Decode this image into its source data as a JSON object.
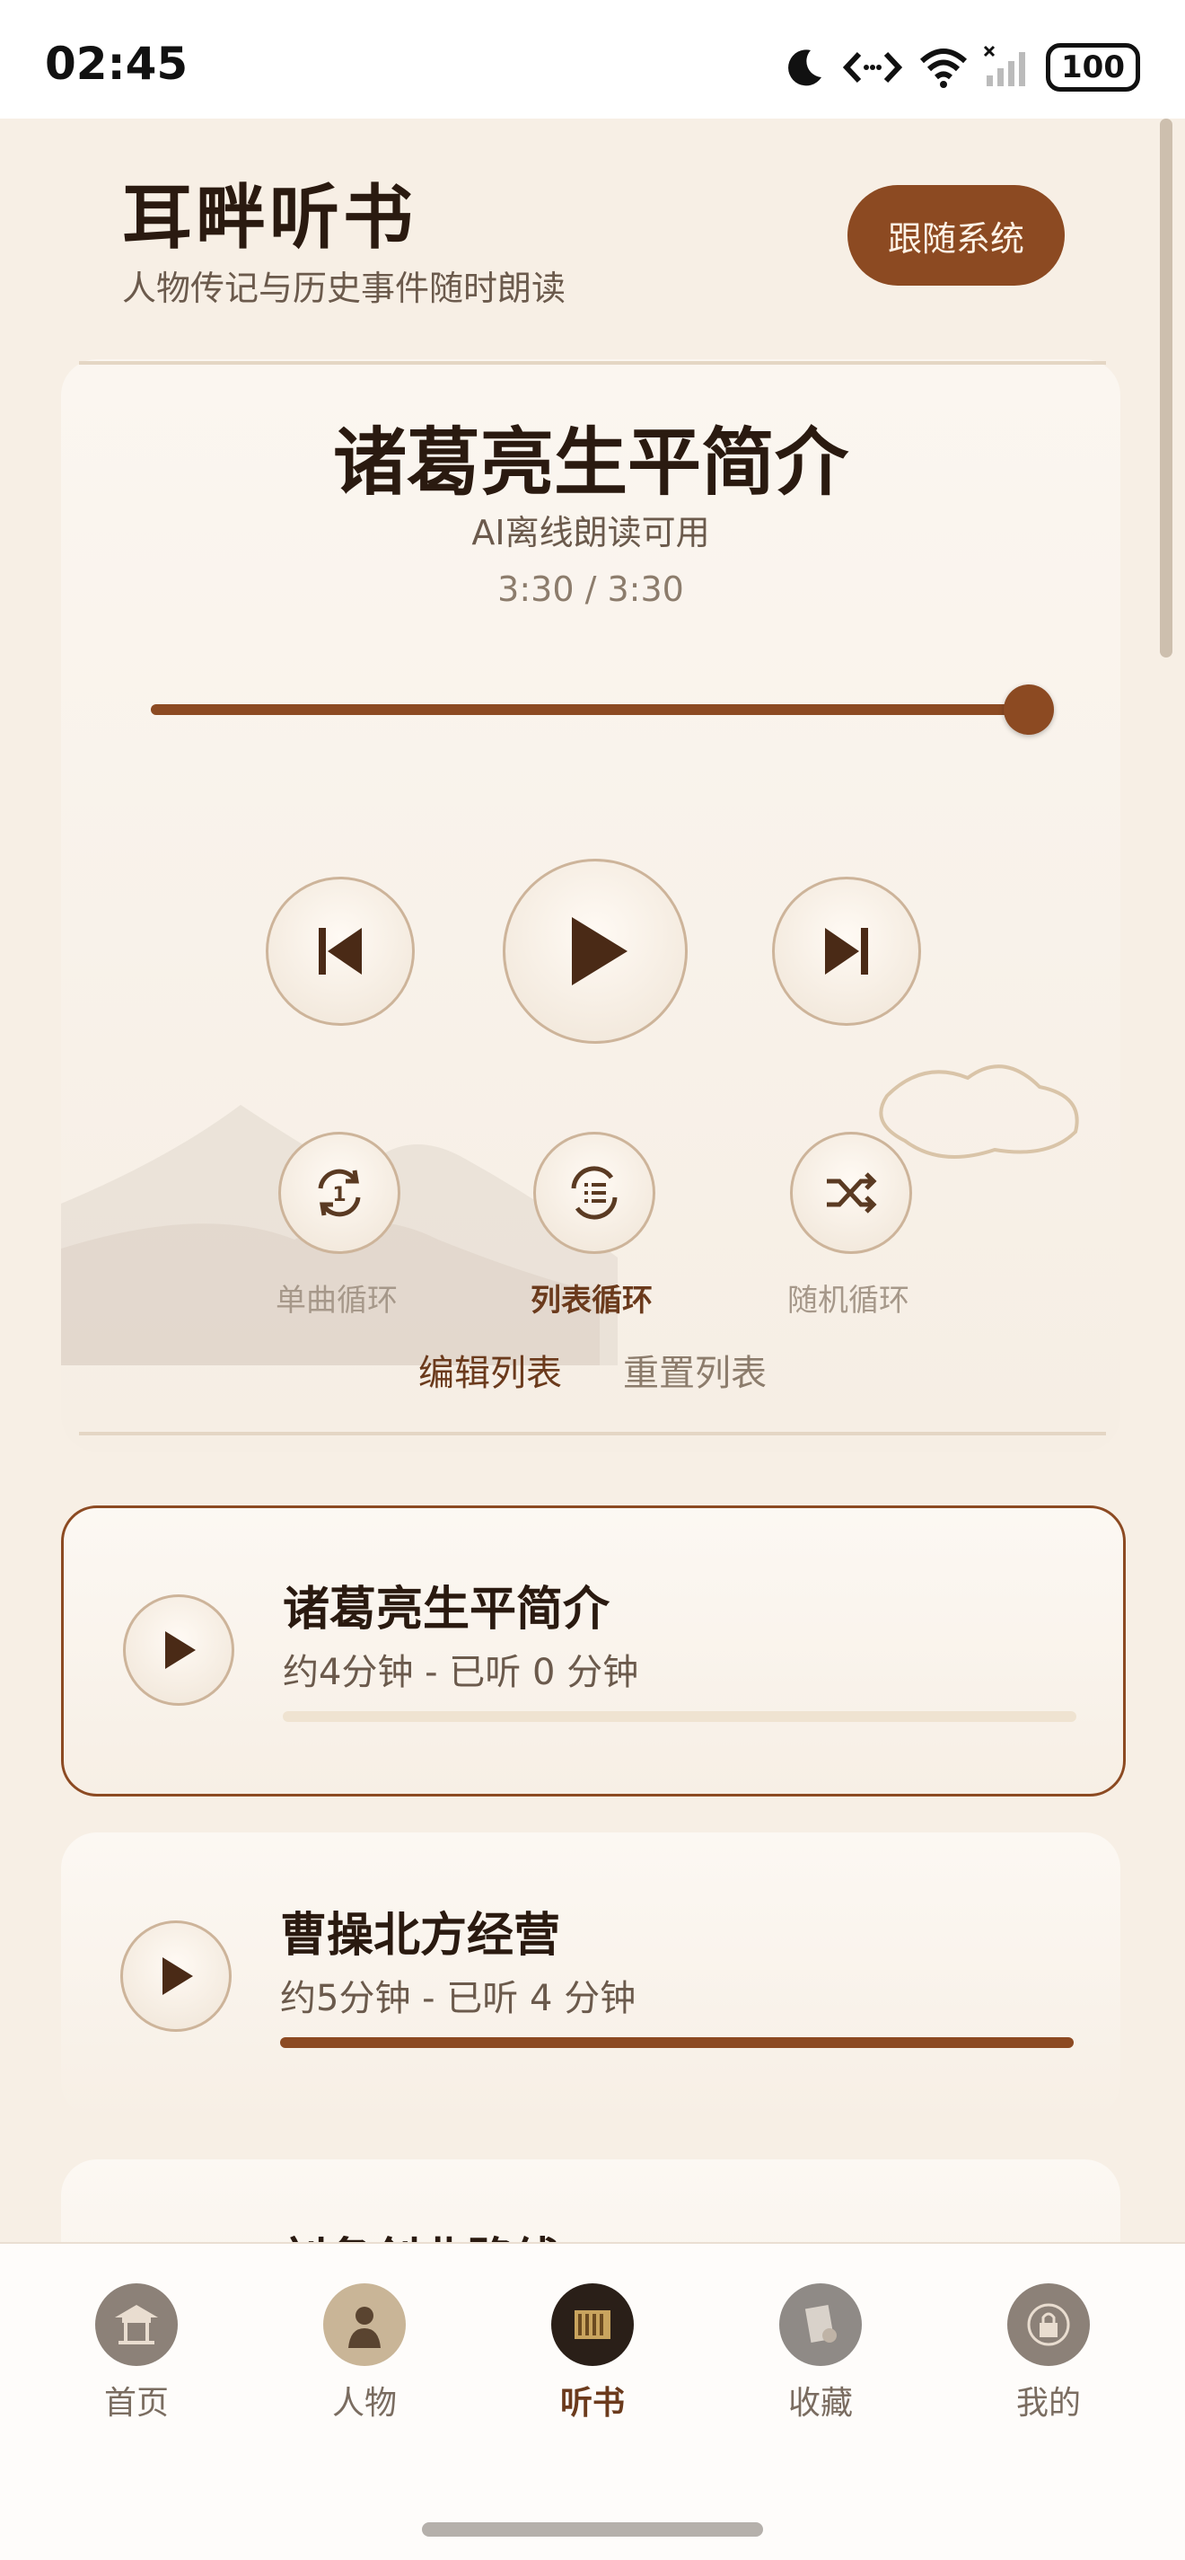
{
  "status": {
    "time": "02:45",
    "battery": "100"
  },
  "header": {
    "title": "耳畔听书",
    "subtitle": "人物传记与历史事件随时朗读",
    "theme_button": "跟随系统"
  },
  "player": {
    "title": "诸葛亮生平简介",
    "subtitle": "AI离线朗读可用",
    "time": "3:30 / 3:30",
    "progress": 1.0,
    "modes": [
      {
        "label": "单曲循环",
        "active": false
      },
      {
        "label": "列表循环",
        "active": true
      },
      {
        "label": "随机循环",
        "active": false
      }
    ],
    "edit_list": "编辑列表",
    "reset_list": "重置列表"
  },
  "tracks": [
    {
      "title": "诸葛亮生平简介",
      "meta": "约4分钟 - 已听 0 分钟",
      "progress": 0.0,
      "active": true
    },
    {
      "title": "曹操北方经营",
      "meta": "约5分钟 - 已听 4 分钟",
      "progress": 1.0,
      "active": false
    },
    {
      "title": "刘备创业路线",
      "meta": "",
      "progress": 0.0,
      "active": false
    }
  ],
  "nav": [
    {
      "label": "首页",
      "icon": "pavilion-icon",
      "active": false
    },
    {
      "label": "人物",
      "icon": "figure-icon",
      "active": false
    },
    {
      "label": "听书",
      "icon": "audio-book-icon",
      "active": true
    },
    {
      "label": "收藏",
      "icon": "collection-icon",
      "active": false
    },
    {
      "label": "我的",
      "icon": "profile-icon",
      "active": false
    }
  ],
  "colors": {
    "accent": "#8c4a22",
    "background": "#f7efe5"
  }
}
